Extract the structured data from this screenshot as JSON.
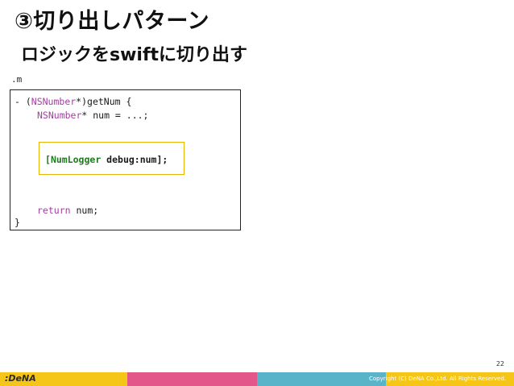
{
  "slide": {
    "title": "③切り出しパターン",
    "subtitle": "ロジックをswiftに切り出す",
    "file_label": ".m",
    "page_number": "22"
  },
  "code": {
    "line1": {
      "dash": "- (",
      "type": "NSNumber",
      "rest": "*)getNum {"
    },
    "line2": {
      "type": "NSNumber",
      "rest": "* num = ...;"
    },
    "line3": {
      "open": "[",
      "cls": "NumLogger",
      "rest": " debug:num];"
    },
    "line4": {
      "kw": "return",
      "rest": " num;"
    },
    "line5": "}"
  },
  "footer": {
    "logo": ":DeNA",
    "copyright": "Copyright (C) DeNA Co.,Ltd. All Rights Reserved.",
    "colors": [
      "#f5c518",
      "#e2568a",
      "#5ab4c9",
      "#f5c518"
    ]
  }
}
